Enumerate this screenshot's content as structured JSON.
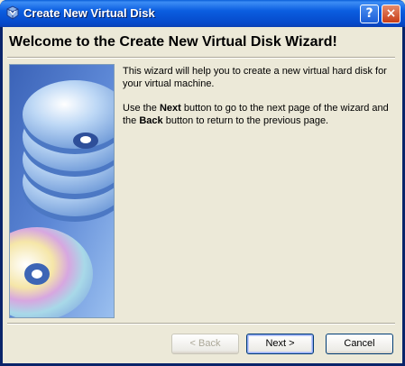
{
  "window": {
    "title": "Create New Virtual Disk",
    "help_label": "?",
    "close_label": "×"
  },
  "wizard": {
    "heading": "Welcome to the Create New Virtual Disk Wizard!",
    "paragraph1": "This wizard will help you to create a new virtual hard disk for your virtual machine.",
    "paragraph2": {
      "part1": "Use the ",
      "next_word": "Next",
      "part2": " button to go to the next page of the wizard and the ",
      "back_word": "Back",
      "part3": " button to return to the previous page."
    }
  },
  "buttons": {
    "back": "< Back",
    "next": "Next >",
    "cancel": "Cancel"
  },
  "colors": {
    "title_bar": "#0548c9",
    "dialog_bg": "#ece9d8",
    "close_button": "#c83d16"
  }
}
